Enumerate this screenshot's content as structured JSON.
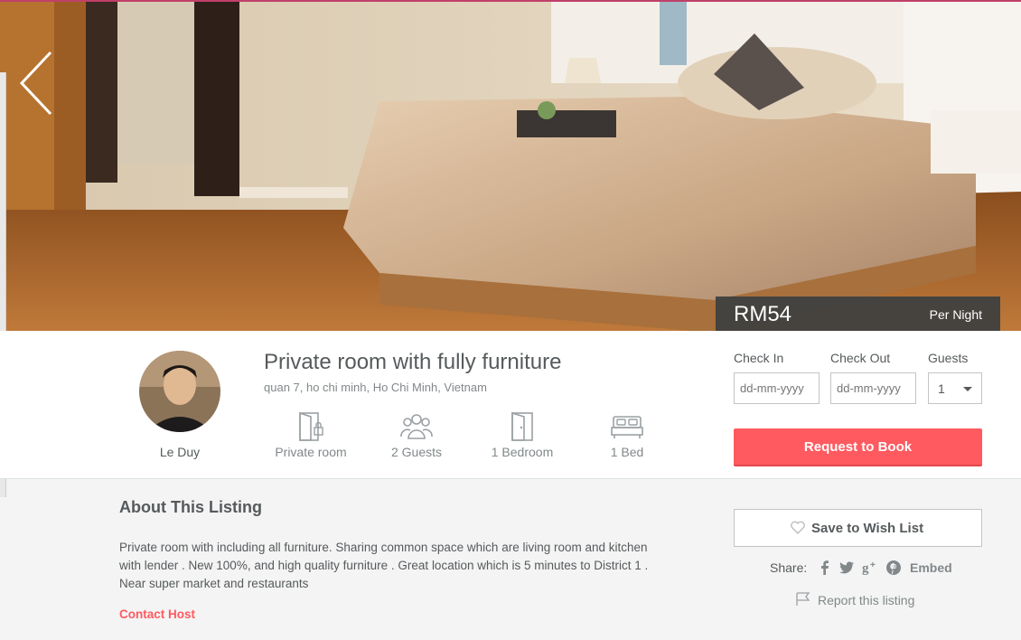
{
  "listing": {
    "price": "RM54",
    "price_unit": "Per Night",
    "title": "Private room with fully furniture",
    "location": "quan 7, ho chi minh, Ho Chi Minh, Vietnam",
    "host_name": "Le Duy",
    "features": [
      {
        "label": "Private room",
        "icon": "door-lock-icon"
      },
      {
        "label": "2 Guests",
        "icon": "guests-icon"
      },
      {
        "label": "1 Bedroom",
        "icon": "door-icon"
      },
      {
        "label": "1 Bed",
        "icon": "bed-icon"
      }
    ]
  },
  "booking": {
    "checkin_label": "Check In",
    "checkout_label": "Check Out",
    "guests_label": "Guests",
    "checkin_placeholder": "dd-mm-yyyy",
    "checkout_placeholder": "dd-mm-yyyy",
    "guests_value": "1",
    "request_button": "Request to Book"
  },
  "about": {
    "title": "About This Listing",
    "description": "Private room with including all furniture. Sharing common space which are living room and kitchen with lender . New 100%, and high quality furniture . Great location which is 5 minutes to District 1 . Near super market and restaurants",
    "contact_link": "Contact Host"
  },
  "actions": {
    "wishlist_button": "Save to Wish List",
    "share_label": "Share:",
    "share_icons": [
      "facebook-icon",
      "twitter-icon",
      "google-plus-icon",
      "pinterest-icon"
    ],
    "embed_label": "Embed",
    "report_label": "Report this listing"
  },
  "colors": {
    "accent": "#ff5a5f",
    "text": "#565a5c",
    "muted": "#82888a",
    "price_bg": "#3c3f40"
  }
}
